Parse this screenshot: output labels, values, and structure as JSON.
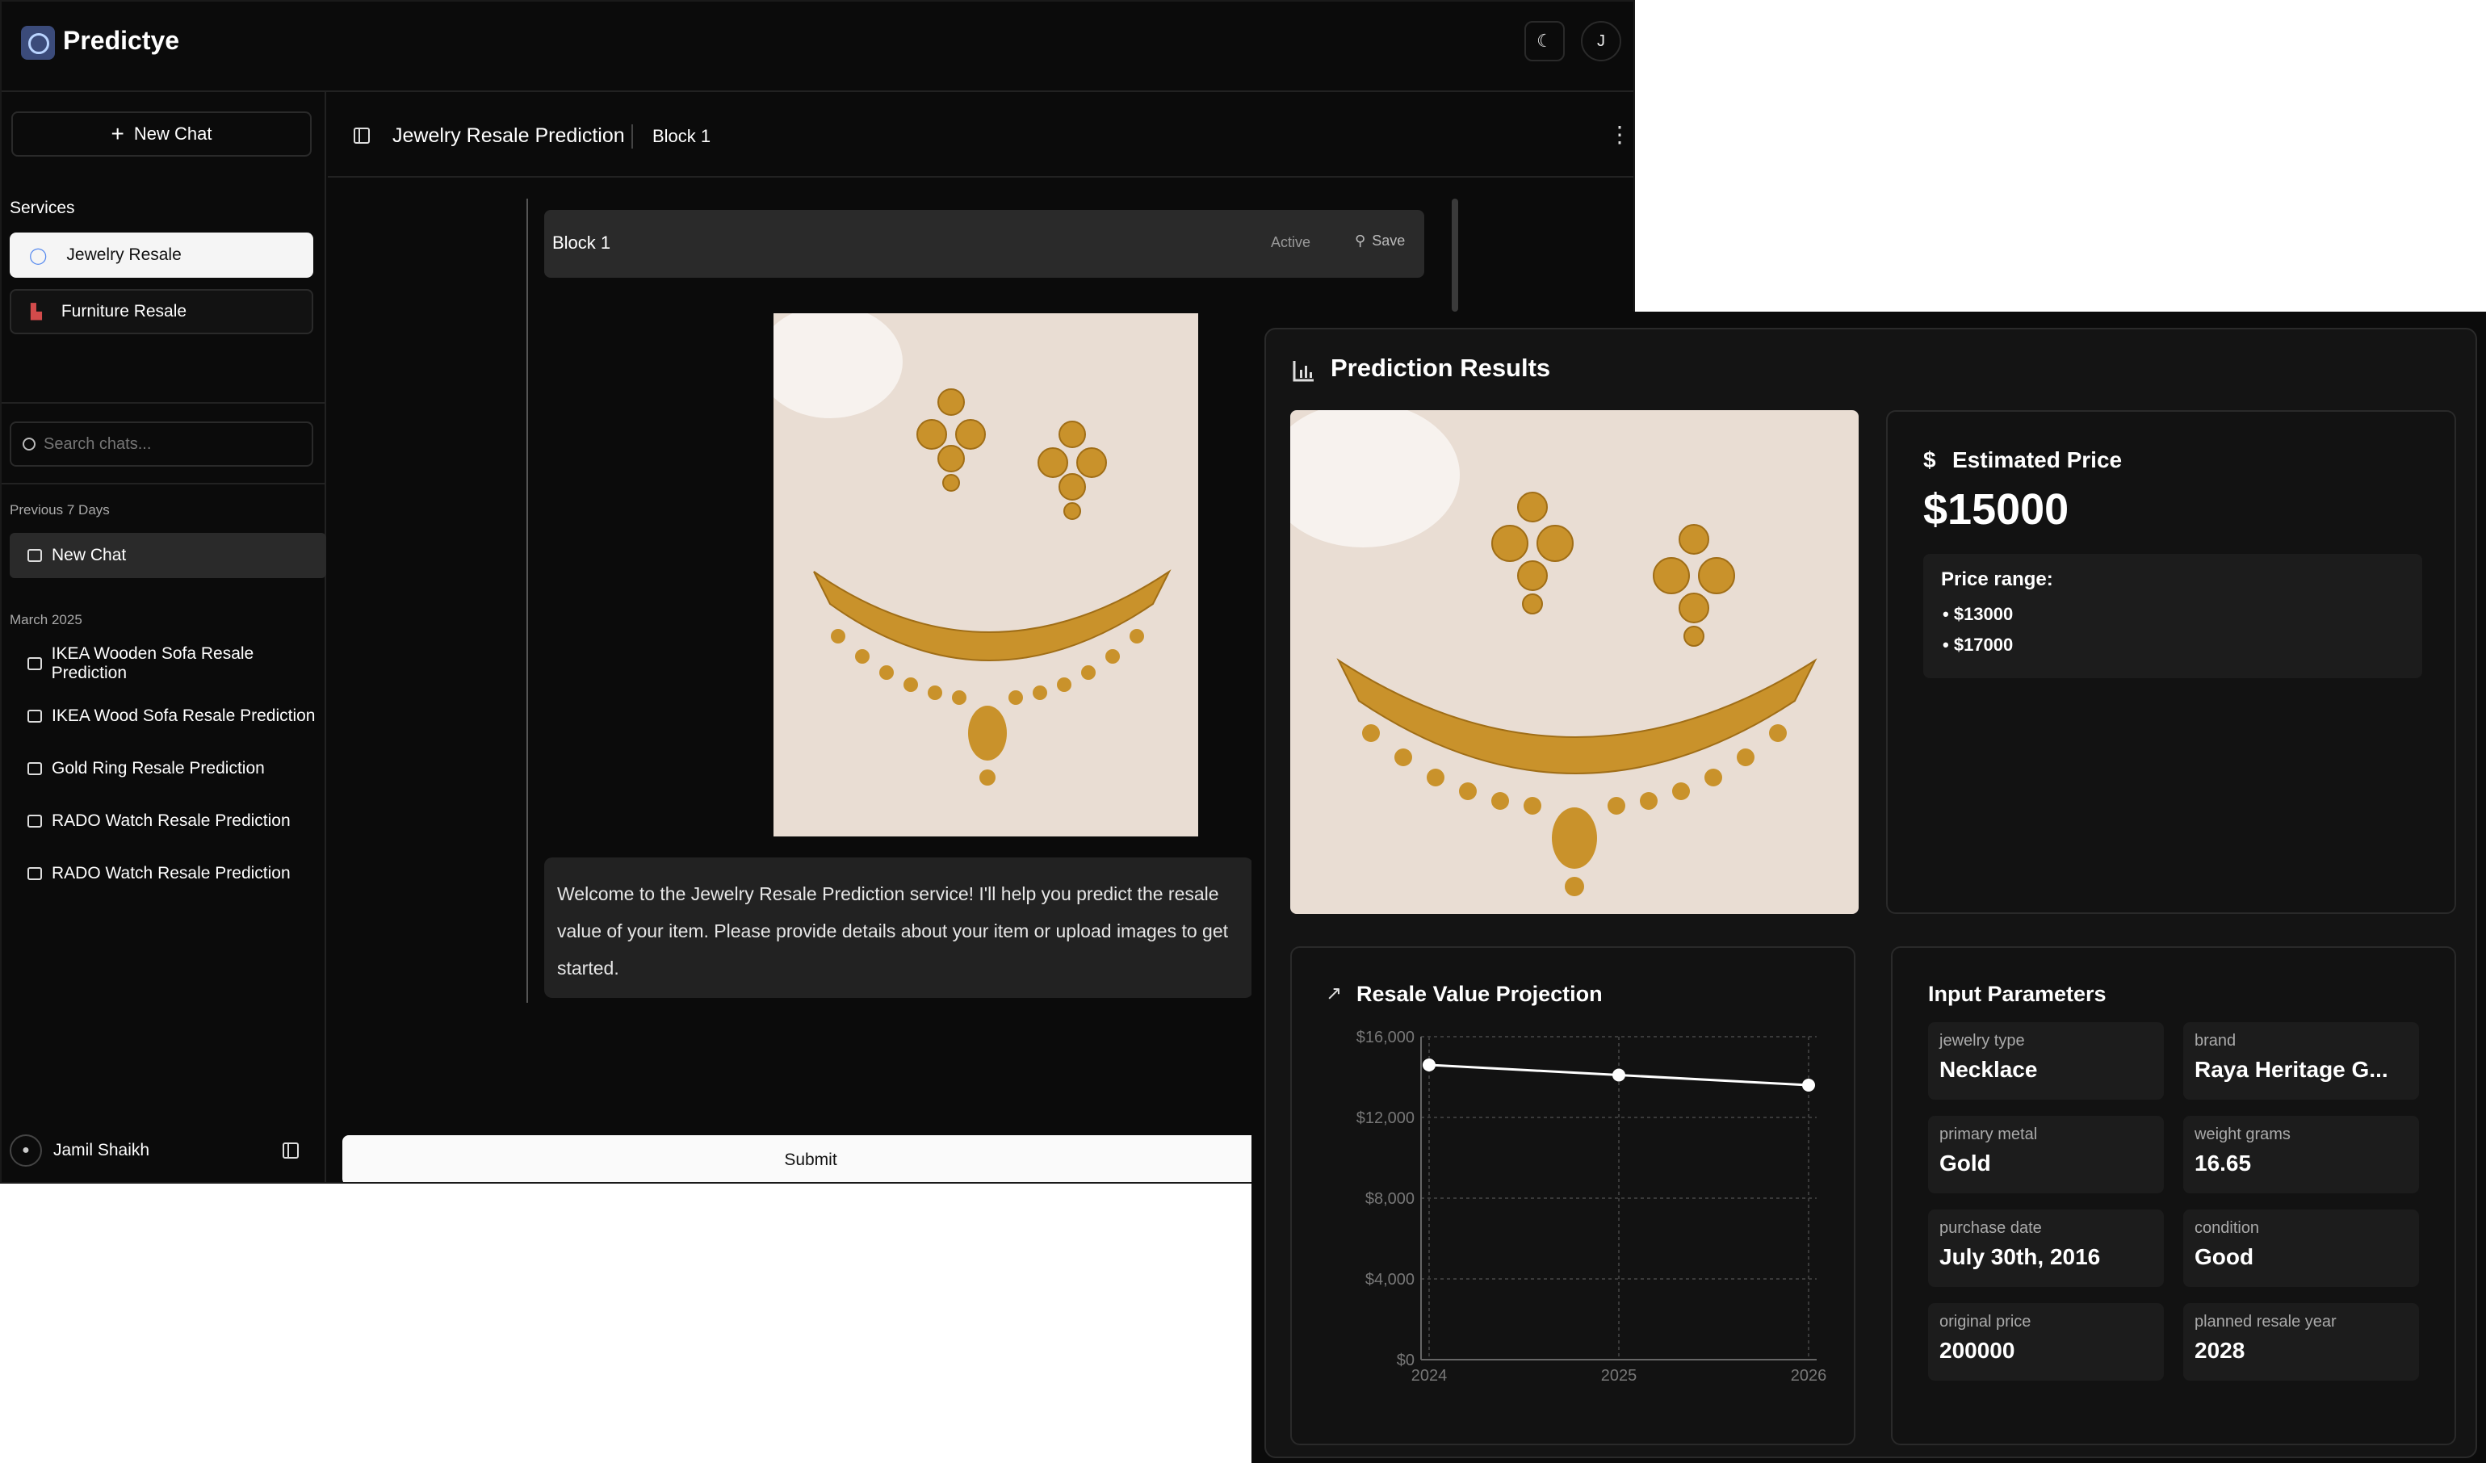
{
  "app": {
    "name": "Predictye",
    "theme_toggle": "☾",
    "user_initial": "J"
  },
  "sidebar": {
    "new_chat_label": "New Chat",
    "services_label": "Services",
    "services": [
      {
        "label": "Jewelry Resale"
      },
      {
        "label": "Furniture Resale"
      }
    ],
    "search_placeholder": "Search chats...",
    "groups": [
      {
        "label": "Previous 7 Days",
        "chats": [
          "New Chat"
        ]
      },
      {
        "label": "March 2025",
        "chats": [
          "IKEA Wooden Sofa Resale Prediction",
          "IKEA Wood Sofa Resale Prediction",
          "Gold Ring Resale Prediction",
          "RADO Watch Resale Prediction",
          "RADO Watch Resale Prediction"
        ]
      }
    ],
    "user_name": "Jamil Shaikh"
  },
  "main": {
    "title": "Jewelry Resale Prediction",
    "block_label": "Block 1",
    "block": {
      "title": "Block 1",
      "status": "Active",
      "save_label": "Save"
    },
    "welcome": "Welcome to the Jewelry Resale Prediction service! I'll help you predict the resale value of your item. Please provide details about your item or upload images to get started.",
    "submit_label": "Submit"
  },
  "results": {
    "title": "Prediction Results",
    "estimated_label": "Estimated Price",
    "estimated_value": "$15000",
    "range_label": "Price range:",
    "range": [
      "$13000",
      "$17000"
    ],
    "projection_title": "Resale Value Projection",
    "params_title": "Input Parameters",
    "params": [
      {
        "key": "jewelry type",
        "value": "Necklace"
      },
      {
        "key": "brand",
        "value": "Raya Heritage G..."
      },
      {
        "key": "primary metal",
        "value": "Gold"
      },
      {
        "key": "weight grams",
        "value": "16.65"
      },
      {
        "key": "purchase date",
        "value": "July 30th, 2016"
      },
      {
        "key": "condition",
        "value": "Good"
      },
      {
        "key": "original price",
        "value": "200000"
      },
      {
        "key": "planned resale year",
        "value": "2028"
      }
    ]
  },
  "chart_data": {
    "type": "line",
    "title": "Resale Value Projection",
    "x": [
      "2024",
      "2025",
      "2026"
    ],
    "series": [
      {
        "values": [
          14600,
          14100,
          13600
        ]
      }
    ],
    "ylim": [
      0,
      16000
    ],
    "yticks": [
      "$0",
      "$4,000",
      "$8,000",
      "$12,000",
      "$16,000"
    ],
    "grid": true
  },
  "colors": {
    "background": "#0b0b0b",
    "card": "#141414",
    "accent": "#ffffff",
    "gold": "#c9922b"
  }
}
